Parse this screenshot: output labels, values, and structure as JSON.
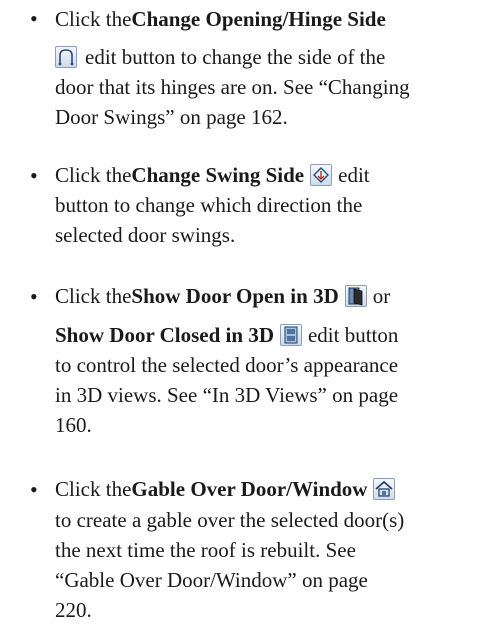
{
  "items": [
    {
      "line1": {
        "pre": "Click the ",
        "bold": "Change Opening/Hinge Side"
      },
      "line2": {
        "post": "edit button to change the side of the"
      },
      "line3": "door that its hinges are on. See “Changing",
      "line4": "Door Swings” on page 162."
    },
    {
      "line1": {
        "pre": "Click the ",
        "bold": "Change Swing Side",
        "post": "edit"
      },
      "line2": "button to change which direction the",
      "line3": "selected door swings."
    },
    {
      "line1": {
        "pre": "Click the ",
        "bold": "Show Door Open in 3D",
        "post": "or"
      },
      "line2": {
        "bold": "Show Door Closed in 3D",
        "post": "edit button"
      },
      "line3": "to control the selected door’s appearance",
      "line4": "in 3D views. See “In 3D Views” on page",
      "line5": "160."
    },
    {
      "line1": {
        "pre": "Click the ",
        "bold": "Gable Over Door/Window"
      },
      "line2": "to create a gable over the selected door(s)",
      "line3": "the next time the roof is rebuilt. See",
      "line4": "“Gable Over Door/Window” on page",
      "line5": "220."
    }
  ],
  "icons": {
    "hinge": "door-hinge-icon",
    "swing": "swing-side-icon",
    "open3d": "door-open-3d-icon",
    "closed3d": "door-closed-3d-icon",
    "gable": "gable-house-icon"
  }
}
